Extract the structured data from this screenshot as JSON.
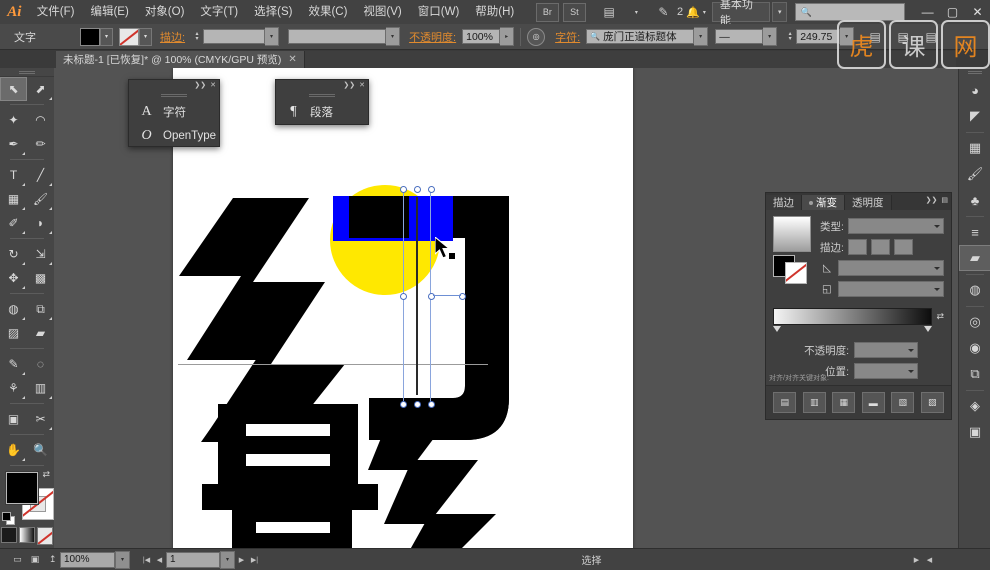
{
  "app": {
    "logo": "Ai",
    "menus": [
      "文件(F)",
      "编辑(E)",
      "对象(O)",
      "文字(T)",
      "选择(S)",
      "效果(C)",
      "视图(V)",
      "窗口(W)",
      "帮助(H)"
    ],
    "bridge_icon": "Br",
    "stock_icon": "St",
    "arrange_icon": "▤",
    "arrange_caret": "▾",
    "fx_icon": "✎",
    "notif_count": "2",
    "bell_icon": "🔔",
    "bell_caret": "▾",
    "workspace": "基本功能",
    "workspace_caret": "▾",
    "search_icon": "🔍",
    "search_value": "",
    "search_placeholder": "",
    "win_minimize": "—",
    "win_maximize": "▢",
    "win_close": "✕"
  },
  "control_bar": {
    "context_label": "文字",
    "fill_swatch_color": "#000000",
    "fill_caret": "▾",
    "stroke_swatch": "none-swatch",
    "stroke_caret": "▾",
    "stroke_label": "描边:",
    "stroke_weight_value": "",
    "stroke_weight_caret": "▾",
    "stroke_profile_value": "",
    "stroke_profile_caret": "▾",
    "opacity_label": "不透明度:",
    "opacity_value": "100%",
    "opacity_caret": "▸",
    "recolor_icon": "◎",
    "character_label": "字符:",
    "font_search_icon": "🔍",
    "font_family": "庞门正道标题体",
    "font_family_caret": "▾",
    "font_style": "—",
    "font_style_caret": "▾",
    "font_size": "249.75",
    "font_size_caret": "▾",
    "align_left_icon": "▤",
    "align_center_icon": "▤",
    "align_right_icon": "▤"
  },
  "document_tab": {
    "title": "未标题-1 [已恢复]* @ 100% (CMYK/GPU 预览)",
    "close": "✕"
  },
  "toolbar": {
    "tools": [
      {
        "name": "selection-tool",
        "glyph": "⬉",
        "active": true,
        "corner": false
      },
      {
        "name": "direct-selection-tool",
        "glyph": "⬈",
        "active": false,
        "corner": true
      },
      {
        "name": "magic-wand-tool",
        "glyph": "✦",
        "active": false,
        "corner": false
      },
      {
        "name": "lasso-tool",
        "glyph": "◠",
        "active": false,
        "corner": false
      },
      {
        "name": "pen-tool",
        "glyph": "✒",
        "active": false,
        "corner": true
      },
      {
        "name": "curvature-tool",
        "glyph": "✏",
        "active": false,
        "corner": false
      },
      {
        "name": "type-tool",
        "glyph": "T",
        "active": false,
        "corner": true
      },
      {
        "name": "line-segment-tool",
        "glyph": "╱",
        "active": false,
        "corner": true
      },
      {
        "name": "rectangle-tool",
        "glyph": "▦",
        "active": false,
        "corner": true
      },
      {
        "name": "paintbrush-tool",
        "glyph": "🖌",
        "active": false,
        "corner": true
      },
      {
        "name": "shaper-tool",
        "glyph": "✐",
        "active": false,
        "corner": true
      },
      {
        "name": "eraser-tool",
        "glyph": "◗",
        "active": false,
        "corner": true
      },
      {
        "name": "rotate-tool",
        "glyph": "↻",
        "active": false,
        "corner": true
      },
      {
        "name": "scale-tool",
        "glyph": "⇲",
        "active": false,
        "corner": true
      },
      {
        "name": "width-tool",
        "glyph": "✥",
        "active": false,
        "corner": true
      },
      {
        "name": "free-transform-tool",
        "glyph": "▩",
        "active": false,
        "corner": false
      },
      {
        "name": "shape-builder-tool",
        "glyph": "◍",
        "active": false,
        "corner": true
      },
      {
        "name": "perspective-grid-tool",
        "glyph": "⧉",
        "active": false,
        "corner": true
      },
      {
        "name": "mesh-tool",
        "glyph": "▨",
        "active": false,
        "corner": false
      },
      {
        "name": "gradient-tool",
        "glyph": "▰",
        "active": false,
        "corner": false
      },
      {
        "name": "eyedropper-tool",
        "glyph": "✎",
        "active": false,
        "corner": true
      },
      {
        "name": "blend-tool",
        "glyph": "◌",
        "active": false,
        "corner": false
      },
      {
        "name": "symbol-sprayer-tool",
        "glyph": "⚘",
        "active": false,
        "corner": true
      },
      {
        "name": "column-graph-tool",
        "glyph": "▥",
        "active": false,
        "corner": true
      },
      {
        "name": "artboard-tool",
        "glyph": "▣",
        "active": false,
        "corner": false
      },
      {
        "name": "slice-tool",
        "glyph": "✂",
        "active": false,
        "corner": true
      },
      {
        "name": "hand-tool",
        "glyph": "✋",
        "active": false,
        "corner": true
      },
      {
        "name": "zoom-tool",
        "glyph": "🔍",
        "active": false,
        "corner": false
      }
    ],
    "fill_color": "#000000",
    "stroke_color": "none",
    "swap_icon": "⇄",
    "default_icon": "default-fill-stroke",
    "mode_color": "color-mode",
    "mode_gradient": "gradient-mode",
    "mode_none": "none-mode",
    "screen_mode_icon": "▣",
    "screen_mode_icon2": "◉",
    "screen_mode_icon3": "▭"
  },
  "panel_character": {
    "close": "✕",
    "collapse": "❯❯",
    "items": [
      {
        "icon": "A",
        "label": "字符"
      },
      {
        "icon": "O",
        "label": "OpenType"
      }
    ]
  },
  "panel_paragraph": {
    "close": "✕",
    "collapse": "❯❯",
    "items": [
      {
        "icon": "¶",
        "label": "段落"
      }
    ]
  },
  "panel_gradient": {
    "tabs": [
      {
        "label": "描边",
        "active": false,
        "dot": false
      },
      {
        "label": "渐变",
        "active": true,
        "dot": true
      },
      {
        "label": "透明度",
        "active": false,
        "dot": false
      }
    ],
    "collapse": "❯❯",
    "menu": "▤",
    "type_label": "类型:",
    "type_value": "",
    "stroke_label": "描边:",
    "stroke_btn1": "gradient-within-stroke",
    "stroke_btn2": "gradient-along-stroke",
    "stroke_btn3": "gradient-across-stroke",
    "angle_label": "◺",
    "angle_value": "",
    "aspect_label": "◱",
    "aspect_value": "",
    "gradient_from": "#ffffff",
    "gradient_to": "#0d0d0d",
    "reverse_icon": "⇄",
    "opacity_label": "不透明度:",
    "opacity_value": "",
    "location_label": "位置:",
    "location_value": "",
    "footer_note": "对齐/对齐关键对象:",
    "footer_icons": [
      "▤",
      "▥",
      "▦",
      "▬",
      "▧",
      "▨"
    ]
  },
  "right_dock": {
    "icons": [
      {
        "name": "color-panel-icon",
        "glyph": "◕",
        "sel": false
      },
      {
        "name": "color-guide-panel-icon",
        "glyph": "◤",
        "sel": false
      },
      {
        "name": "swatches-panel-icon",
        "glyph": "▦",
        "sel": false
      },
      {
        "name": "brushes-panel-icon",
        "glyph": "🖌",
        "sel": false
      },
      {
        "name": "symbols-panel-icon",
        "glyph": "♣",
        "sel": false
      },
      {
        "name": "stroke-panel-icon",
        "glyph": "≡",
        "sel": false
      },
      {
        "name": "gradient-panel-icon",
        "glyph": "▰",
        "sel": true
      },
      {
        "name": "transparency-panel-icon",
        "glyph": "◍",
        "sel": false
      },
      {
        "name": "appearance-panel-icon",
        "glyph": "◎",
        "sel": false
      },
      {
        "name": "graphic-styles-panel-icon",
        "glyph": "◉",
        "sel": false
      },
      {
        "name": "transform-panel-icon",
        "glyph": "⧉",
        "sel": false
      },
      {
        "name": "layers-panel-icon",
        "glyph": "◈",
        "sel": false
      },
      {
        "name": "artboards-panel-icon",
        "glyph": "▣",
        "sel": false
      }
    ]
  },
  "status_bar": {
    "view_icon1": "▭",
    "view_icon2": "▣",
    "share_icon": "↥",
    "zoom_value": "100%",
    "zoom_caret": "▾",
    "nav_first": "|◀",
    "nav_prev": "◀",
    "page_value": "1",
    "page_caret": "▾",
    "nav_next": "▶",
    "nav_last": "▶|",
    "tool_status": "选择",
    "scroll_right": "▶",
    "scroll_left": "◀"
  },
  "artwork": {
    "glyph_top": "幻",
    "glyph_bottom": "影",
    "circle_color": "#FFE800",
    "rect_color": "#0000FF",
    "text_color": "#000000",
    "artboard_color": "#ffffff"
  },
  "watermark": {
    "chars": [
      "虎",
      "课",
      "网"
    ]
  }
}
